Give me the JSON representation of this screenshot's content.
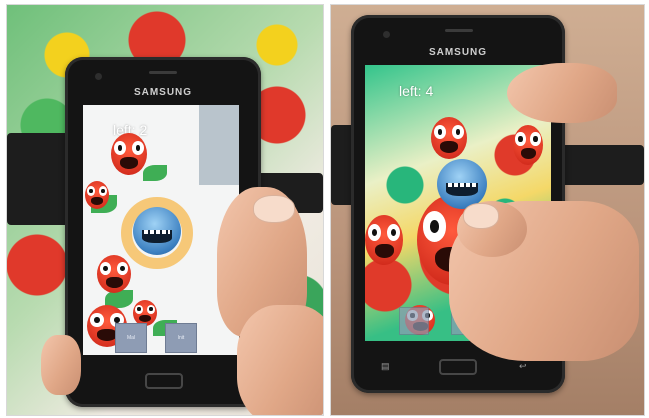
{
  "photos": [
    {
      "id": "left",
      "phone_brand": "SAMSUNG",
      "game_status": "left: 2",
      "buttons": [
        "Mal",
        "Init"
      ]
    },
    {
      "id": "right",
      "phone_brand": "SAMSUNG",
      "game_status": "left: 4"
    }
  ],
  "icons": [
    "camera-icon",
    "back-icon",
    "menu-icon"
  ]
}
